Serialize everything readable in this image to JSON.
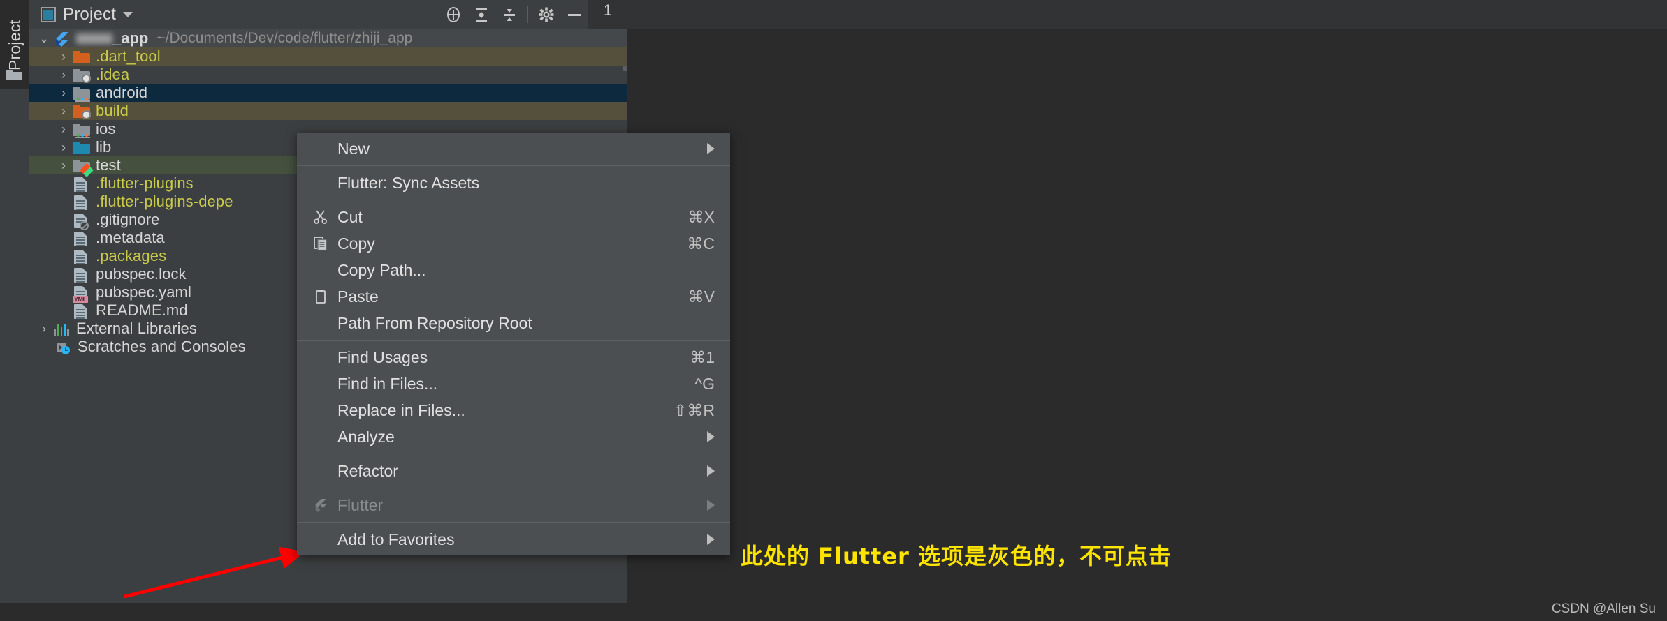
{
  "window": {
    "tool_window_tab": "Project",
    "tool_window_title": "Project",
    "index_badge": "1",
    "actions": [
      {
        "name": "locate-icon",
        "tooltip": "Select Opened File"
      },
      {
        "name": "expand-all-icon",
        "tooltip": "Expand All"
      },
      {
        "name": "collapse-all-icon",
        "tooltip": "Collapse All"
      },
      {
        "name": "gear-icon",
        "tooltip": "Settings"
      },
      {
        "name": "minimize-icon",
        "tooltip": "Hide"
      }
    ]
  },
  "tree": {
    "root": {
      "label": "_app",
      "label_prefix_blurred": true,
      "path": "~/Documents/Dev/code/flutter/zhiji_app",
      "icon": "flutter-logo-icon",
      "expanded": true
    },
    "items": [
      {
        "label": ".dart_tool",
        "icon": "folder-orange-icon",
        "color": "#c9c94a",
        "indent": 1,
        "chevron": true,
        "highlight": "olive"
      },
      {
        "label": ".idea",
        "icon": "folder-gray-fan-icon",
        "color": "#c9c94a",
        "indent": 1,
        "chevron": true,
        "highlight": "none"
      },
      {
        "label": "android",
        "icon": "folder-android-icon",
        "color": "#d6d6d6",
        "indent": 1,
        "chevron": true,
        "highlight": "blue"
      },
      {
        "label": "build",
        "icon": "folder-orange-fan-icon",
        "color": "#c9c94a",
        "indent": 1,
        "chevron": true,
        "highlight": "olive"
      },
      {
        "label": "ios",
        "icon": "folder-ios-icon",
        "color": "#d6d6d6",
        "indent": 1,
        "chevron": true,
        "highlight": "none"
      },
      {
        "label": "lib",
        "icon": "folder-blue-icon",
        "color": "#d6d6d6",
        "indent": 1,
        "chevron": true,
        "highlight": "none"
      },
      {
        "label": "test",
        "icon": "folder-test-dart-icon",
        "color": "#d6d6d6",
        "indent": 1,
        "chevron": true,
        "highlight": "green"
      },
      {
        "label": ".flutter-plugins",
        "icon": "file-text-icon",
        "color": "#c9c94a",
        "indent": 2,
        "chevron": false,
        "highlight": "none"
      },
      {
        "label": ".flutter-plugins-depe",
        "icon": "file-text-icon",
        "color": "#c9c94a",
        "indent": 2,
        "chevron": false,
        "highlight": "none"
      },
      {
        "label": ".gitignore",
        "icon": "file-gitignore-icon",
        "color": "#d6d6d6",
        "indent": 2,
        "chevron": false,
        "highlight": "none"
      },
      {
        "label": ".metadata",
        "icon": "file-text-icon",
        "color": "#d6d6d6",
        "indent": 2,
        "chevron": false,
        "highlight": "none"
      },
      {
        "label": ".packages",
        "icon": "file-text-icon",
        "color": "#c9c94a",
        "indent": 2,
        "chevron": false,
        "highlight": "none"
      },
      {
        "label": "pubspec.lock",
        "icon": "file-text-icon",
        "color": "#d6d6d6",
        "indent": 2,
        "chevron": false,
        "highlight": "none"
      },
      {
        "label": "pubspec.yaml",
        "icon": "file-yaml-icon",
        "color": "#d6d6d6",
        "indent": 2,
        "chevron": false,
        "highlight": "none"
      },
      {
        "label": "README.md",
        "icon": "file-text-icon",
        "color": "#d6d6d6",
        "indent": 2,
        "chevron": false,
        "highlight": "none"
      },
      {
        "label": "External Libraries",
        "icon": "libraries-icon",
        "color": "#d6d6d6",
        "indent": 0,
        "chevron": true,
        "highlight": "none"
      },
      {
        "label": "Scratches and Consoles",
        "icon": "scratches-icon",
        "color": "#d6d6d6",
        "indent": 1,
        "chevron": false,
        "highlight": "none"
      }
    ]
  },
  "context_menu": {
    "groups": [
      {
        "items": [
          {
            "label": "New",
            "shortcut": "",
            "submenu": true,
            "icon": "",
            "disabled": false
          }
        ]
      },
      {
        "items": [
          {
            "label": "Flutter: Sync Assets",
            "shortcut": "",
            "submenu": false,
            "icon": "",
            "disabled": false
          }
        ]
      },
      {
        "items": [
          {
            "label": "Cut",
            "shortcut": "⌘X",
            "submenu": false,
            "icon": "scissors-icon",
            "disabled": false
          },
          {
            "label": "Copy",
            "shortcut": "⌘C",
            "submenu": false,
            "icon": "copy-icon",
            "disabled": false
          },
          {
            "label": "Copy Path...",
            "shortcut": "",
            "submenu": false,
            "icon": "",
            "disabled": false
          },
          {
            "label": "Paste",
            "shortcut": "⌘V",
            "submenu": false,
            "icon": "clipboard-icon",
            "disabled": false
          },
          {
            "label": "Path From Repository Root",
            "shortcut": "",
            "submenu": false,
            "icon": "",
            "disabled": false
          }
        ]
      },
      {
        "items": [
          {
            "label": "Find Usages",
            "shortcut": "⌘1",
            "submenu": false,
            "icon": "",
            "disabled": false
          },
          {
            "label": "Find in Files...",
            "shortcut": "^G",
            "submenu": false,
            "icon": "",
            "disabled": false
          },
          {
            "label": "Replace in Files...",
            "shortcut": "⇧⌘R",
            "submenu": false,
            "icon": "",
            "disabled": false
          },
          {
            "label": "Analyze",
            "shortcut": "",
            "submenu": true,
            "icon": "",
            "disabled": false
          }
        ]
      },
      {
        "items": [
          {
            "label": "Refactor",
            "shortcut": "",
            "submenu": true,
            "icon": "",
            "disabled": false
          }
        ]
      },
      {
        "items": [
          {
            "label": "Flutter",
            "shortcut": "",
            "submenu": true,
            "icon": "flutter-icon",
            "disabled": true
          }
        ]
      },
      {
        "items": [
          {
            "label": "Add to Favorites",
            "shortcut": "",
            "submenu": true,
            "icon": "",
            "disabled": false
          }
        ]
      }
    ]
  },
  "annotations": {
    "note_text": "此处的 Flutter 选项是灰色的，不可点击",
    "note_color": "#ffe400",
    "arrow_color": "#ff0000",
    "watermark": "CSDN @Allen Su"
  }
}
